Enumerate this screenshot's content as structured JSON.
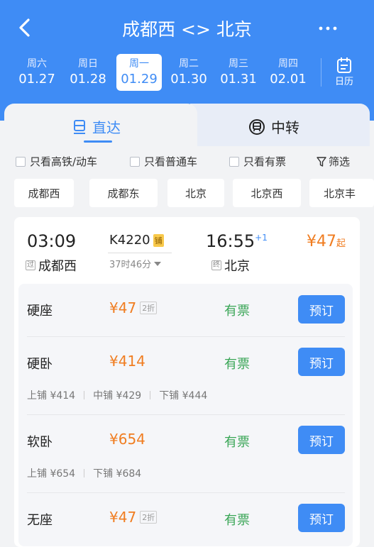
{
  "header": {
    "title": "成都西 <> 北京",
    "back_icon": "chevron-left-icon",
    "more_icon": "more-dots-icon"
  },
  "dates": [
    {
      "weekday": "周六",
      "date": "01.27"
    },
    {
      "weekday": "周日",
      "date": "01.28"
    },
    {
      "weekday": "周一",
      "date": "01.29",
      "selected": true
    },
    {
      "weekday": "周二",
      "date": "01.30"
    },
    {
      "weekday": "周三",
      "date": "01.31"
    },
    {
      "weekday": "周四",
      "date": "02.01"
    }
  ],
  "calendar": {
    "label": "日历",
    "icon": "calendar-icon"
  },
  "tabs": {
    "direct": {
      "label": "直达",
      "icon": "train-icon"
    },
    "transfer": {
      "label": "中转",
      "icon": "transfer-icon"
    }
  },
  "filters": {
    "high_speed": "只看高铁/动车",
    "normal": "只看普通车",
    "available": "只看有票",
    "filter": "筛选",
    "filter_icon": "funnel-icon"
  },
  "stations": [
    "成都西",
    "成都东",
    "北京",
    "北京西",
    "北京丰"
  ],
  "train": {
    "dep_time": "03:09",
    "dep_tag": "过",
    "dep_station": "成都西",
    "number": "K4220",
    "berth_badge": "铺",
    "duration": "37时46分",
    "arr_time": "16:55",
    "day_offset": "+1",
    "arr_tag": "终",
    "arr_station": "北京",
    "price": "¥47",
    "price_suffix": "起"
  },
  "seats": [
    {
      "name": "硬座",
      "price": "¥47",
      "discount": "2折",
      "status": "有票",
      "button": "预订"
    },
    {
      "name": "硬卧",
      "price": "¥414",
      "status": "有票",
      "button": "预订",
      "berths": [
        "上铺 ¥414",
        "中铺 ¥429",
        "下铺 ¥444"
      ]
    },
    {
      "name": "软卧",
      "price": "¥654",
      "status": "有票",
      "button": "预订",
      "berths": [
        "上铺 ¥654",
        "下铺 ¥684"
      ]
    },
    {
      "name": "无座",
      "price": "¥47",
      "discount": "2折",
      "status": "有票",
      "button": "预订"
    }
  ],
  "colors": {
    "primary": "#3f8cf5",
    "price": "#f07d21",
    "available": "#3aa657"
  }
}
